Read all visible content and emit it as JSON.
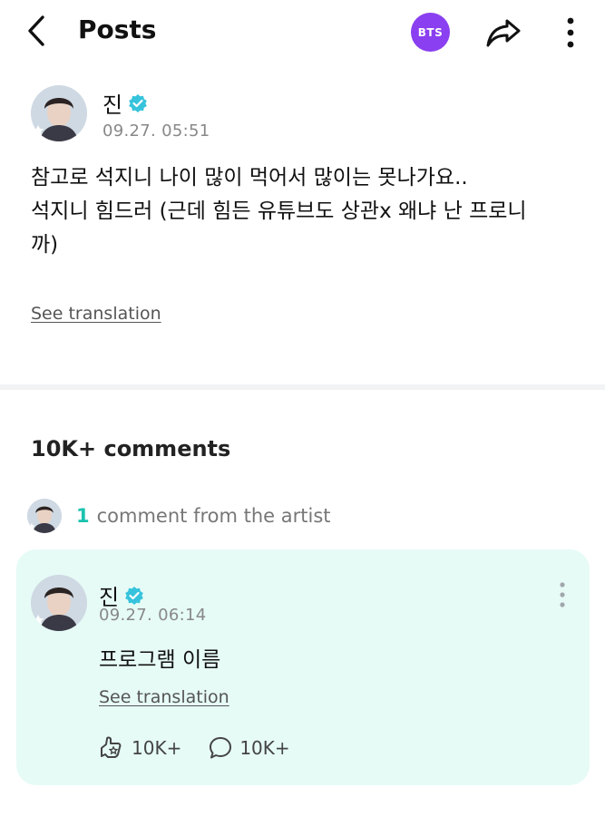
{
  "header": {
    "title": "Posts",
    "community_badge": "BTS"
  },
  "post": {
    "author": "진",
    "timestamp": "09.27. 05:51",
    "lines": [
      "참고로 석지니 나이 많이 먹어서 많이는 못나가요..",
      "석지니 힘드러 (근데 힘든 유튜브도 상관x 왜냐 난 프로니",
      "까)"
    ],
    "see_translation": "See translation"
  },
  "comments": {
    "title": "10K+ comments",
    "artist_count": "1",
    "artist_label": "comment from the artist",
    "artist_comment": {
      "author": "진",
      "timestamp": "09.27. 06:14",
      "text": "프로그램 이름",
      "see_translation": "See translation",
      "likes": "10K+",
      "replies": "10K+"
    }
  },
  "colors": {
    "accent": "#1bc3b0",
    "badge": "#8a3ff0",
    "card_bg": "#e6fbf6",
    "verified": "#37c3dc"
  },
  "icons": [
    "back-arrow-icon",
    "share-icon",
    "more-vertical-icon",
    "verified-icon",
    "like-icon",
    "comment-bubble-icon"
  ]
}
